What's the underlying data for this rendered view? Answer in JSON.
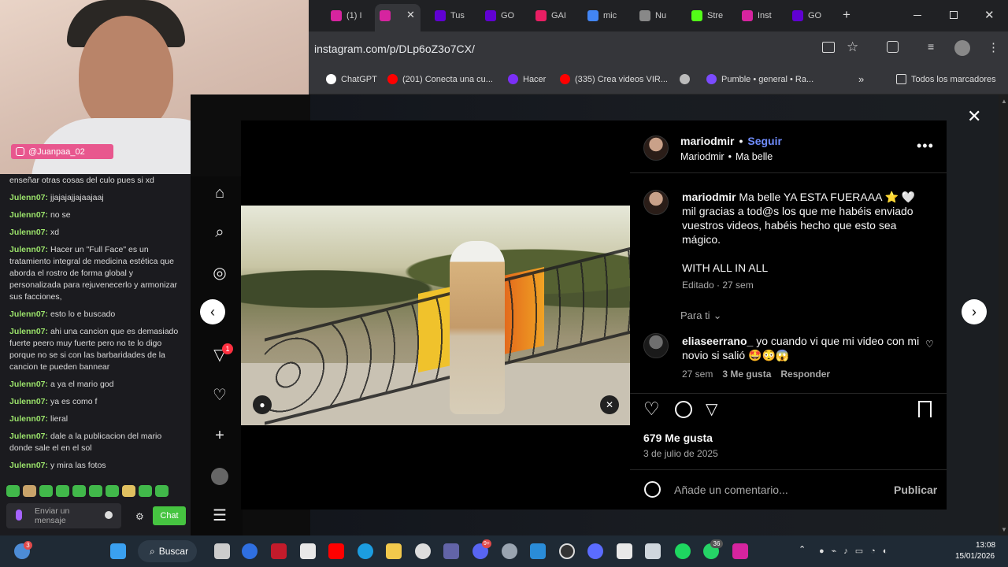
{
  "webcam": {
    "handle": "@Juanpaa_02"
  },
  "chat": {
    "messages": [
      {
        "user": "",
        "text": "enseñar otras cosas del culo pues si xd"
      },
      {
        "user": "Julenn07:",
        "text": "jjajajajjajaajaaj"
      },
      {
        "user": "Julenn07:",
        "text": "no se"
      },
      {
        "user": "Julenn07:",
        "text": "xd"
      },
      {
        "user": "Julenn07:",
        "text": "Hacer un \"Full Face\" es un tratamiento integral de medicina estética que aborda el rostro de forma global y personalizada para rejuvenecerlo y armonizar sus facciones,"
      },
      {
        "user": "Julenn07:",
        "text": "esto lo e buscado"
      },
      {
        "user": "Julenn07:",
        "text": "ahi una cancion que es demasiado fuerte peero muy fuerte pero no te lo digo porque no se si con las barbaridades de la cancion te pueden bannear"
      },
      {
        "user": "Julenn07:",
        "text": "a ya el mario god"
      },
      {
        "user": "Julenn07:",
        "text": "ya es como f"
      },
      {
        "user": "Julenn07:",
        "text": "lieral"
      },
      {
        "user": "Julenn07:",
        "text": "dale a la publicacion del mario donde sale el en el sol"
      },
      {
        "user": "Julenn07:",
        "text": "y mira las fotos"
      }
    ],
    "input_placeholder": "Enviar un mensaje",
    "chat_button": "Chat"
  },
  "browser": {
    "tabs": [
      {
        "label": "(1) I",
        "color": "#d6249f"
      },
      {
        "label": "",
        "color": "#d6249f"
      },
      {
        "label": "Tus",
        "color": "#6001d2"
      },
      {
        "label": "GO",
        "color": "#6001d2"
      },
      {
        "label": "GAI",
        "color": "#e91e63"
      },
      {
        "label": "mic",
        "color": "#4285f4"
      },
      {
        "label": "Nu",
        "color": "#888888"
      },
      {
        "label": "Stre",
        "color": "#53fc18"
      },
      {
        "label": "Inst",
        "color": "#d6249f"
      },
      {
        "label": "GO",
        "color": "#6001d2"
      }
    ],
    "url": "instagram.com/p/DLp6oZ3o7CX/",
    "bookmarks": [
      {
        "label": "ChatGPT",
        "color": "#ffffff"
      },
      {
        "label": "(201) Conecta una cu...",
        "color": "#ff0000"
      },
      {
        "label": "Hacer",
        "color": "#7b2ff7"
      },
      {
        "label": "(335) Crea videos VIR...",
        "color": "#ff0000"
      },
      {
        "label": "",
        "color": "#bbbbbb"
      },
      {
        "label": "Pumble • general • Ra...",
        "color": "#7b4bff"
      }
    ],
    "all_bookmarks": "Todos los marcadores"
  },
  "post": {
    "username": "mariodmir",
    "follow": "Seguir",
    "follow_separator": "•",
    "subtitle_user": "Mariodmir",
    "subtitle_separator": "•",
    "subtitle_audio": "Ma belle",
    "caption_user": "mariodmir",
    "caption_text": "Ma belle YA ESTA FUERAAA ⭐ 🤍 mil gracias a tod@s los que me habéis enviado vuestros videos, habéis hecho que esto sea mágico.",
    "caption_extra": "WITH ALL IN ALL",
    "edited": "Editado · 27 sem",
    "para_ti": "Para ti",
    "comment_user": "eliaseerrano_",
    "comment_text": "yo cuando vi que mi video con mi novio si salió 🤩😳😱",
    "comment_time": "27 sem",
    "comment_likes": "3 Me gusta",
    "comment_reply": "Responder",
    "likes": "679 Me gusta",
    "date": "3 de julio de 2025",
    "add_comment_placeholder": "Añade un comentario...",
    "publish": "Publicar"
  },
  "taskbar": {
    "search": "Buscar",
    "weather_badge": "3",
    "whatsapp_badge": "36",
    "discord_badge": "9+",
    "time": "13:08",
    "date": "15/01/2026"
  },
  "notif_badge": "1",
  "colors": {
    "accent_follow": "#708dff",
    "ig_pink": "#d6249f",
    "chat_user": "#9be36b"
  }
}
